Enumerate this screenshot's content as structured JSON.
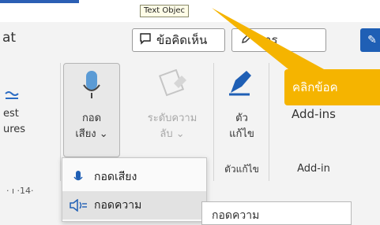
{
  "topbar": {
    "tooltip": "Text Objec"
  },
  "row2": {
    "left_text": "at",
    "comment_button": "ข้อคิดเห็น",
    "edit_button": "การ"
  },
  "ribbon": {
    "left_group": {
      "line1": "est",
      "line2": "ures"
    },
    "dictate": {
      "line1": "กอด",
      "line2": "เสียง ⌄"
    },
    "sensitivity": {
      "line1": "ระดับความ",
      "line2": "ลับ ⌄"
    },
    "editor": {
      "line1": "ตัว",
      "line2": "แก้ไข",
      "group": "ตัวแก้ไข"
    },
    "addins": {
      "label": "Add-ins",
      "group": "Add-in"
    }
  },
  "ruler_text": "·  ı  ·14·",
  "dropdown": {
    "items": [
      {
        "label": "กอดเสียง",
        "icon": "microphone-icon"
      },
      {
        "label": "กอดความ",
        "icon": "read-aloud-icon"
      }
    ]
  },
  "hover_tooltip": "กอดความ",
  "callout": {
    "text": "คลิกข้อค",
    "color": "#f5b400"
  },
  "colors": {
    "accent": "#1f5fb5",
    "callout": "#f5b400"
  }
}
